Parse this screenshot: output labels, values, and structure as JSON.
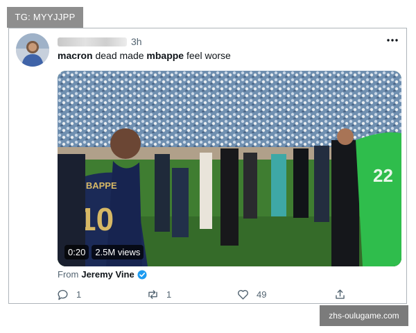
{
  "tag": {
    "label": "TG: MYYJJPP"
  },
  "tweet": {
    "author_handle": "@",
    "time": "3h",
    "text_parts": {
      "w1": "macron",
      "w2": " dead made ",
      "w3": "mbappe",
      "w4": " feel worse"
    },
    "video": {
      "duration": "0:20",
      "views": "2.5M views"
    },
    "jersey": {
      "number": "10",
      "name": "MBAPPE",
      "keeper_number": "22"
    },
    "source": {
      "from_label": "From",
      "name": "Jeremy Vine"
    },
    "actions": {
      "replies": "1",
      "retweets": "1",
      "likes": "49"
    }
  },
  "watermark": {
    "label": "zhs-oulugame.com"
  },
  "colors": {
    "verified": "#1d9bf0",
    "border": "#aeb4b9",
    "muted": "#536471"
  }
}
